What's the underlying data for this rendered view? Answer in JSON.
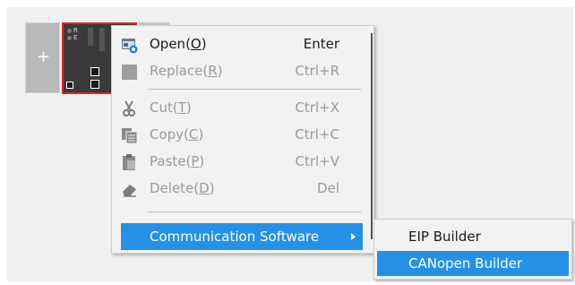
{
  "device_rail": {
    "add_slot_icon": "plus-icon",
    "led_labels": [
      "R",
      "E"
    ],
    "selected_color": "#e51f1f"
  },
  "context_menu": {
    "items": [
      {
        "label": "Open(O)",
        "mnemonic": "O",
        "shortcut": "Enter",
        "icon": "open-icon",
        "enabled": true
      },
      {
        "label": "Replace(R)",
        "mnemonic": "R",
        "shortcut": "Ctrl+R",
        "icon": "replace-icon",
        "enabled": false
      },
      {
        "label": "Cut(T)",
        "mnemonic": "T",
        "shortcut": "Ctrl+X",
        "icon": "scissors-icon",
        "enabled": false
      },
      {
        "label": "Copy(C)",
        "mnemonic": "C",
        "shortcut": "Ctrl+C",
        "icon": "copy-icon",
        "enabled": false
      },
      {
        "label": "Paste(P)",
        "mnemonic": "P",
        "shortcut": "Ctrl+V",
        "icon": "paste-icon",
        "enabled": false
      },
      {
        "label": "Delete(D)",
        "mnemonic": "D",
        "shortcut": "Del",
        "icon": "eraser-icon",
        "enabled": false
      },
      {
        "label": "Communication Software",
        "shortcut": "",
        "icon": "chevron-right-icon",
        "enabled": true,
        "highlighted": true,
        "has_submenu": true
      }
    ]
  },
  "submenu": {
    "items": [
      {
        "label": "EIP Builder",
        "highlighted": false
      },
      {
        "label": "CANopen Builder",
        "highlighted": true
      }
    ]
  },
  "colors": {
    "highlight": "#2591e6",
    "disabled_text": "#9a9a9a",
    "menu_background": "#f2f2f2"
  }
}
